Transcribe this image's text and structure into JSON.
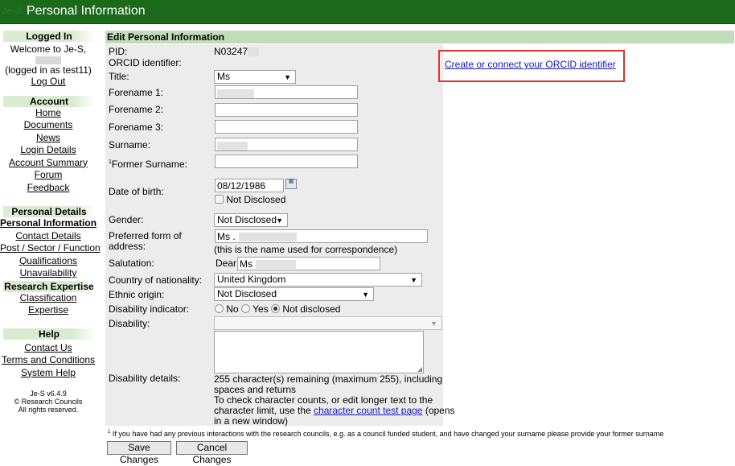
{
  "header": {
    "logo_text": "Je-S",
    "title": "Personal Information"
  },
  "sidebar": {
    "logged_in": {
      "heading": "Logged In",
      "welcome": "Welcome to Je-S,",
      "logged_as": "(logged in as test11)",
      "logout": "Log Out"
    },
    "account": {
      "heading": "Account",
      "items": [
        "Home",
        "Documents",
        "News",
        "Login Details",
        "Account Summary",
        "Forum",
        "Feedback"
      ]
    },
    "personal": {
      "heading": "Personal Details",
      "items": [
        "Personal Information",
        "Contact Details",
        "Post / Sector / Function",
        "Qualifications",
        "Unavailability"
      ]
    },
    "research": {
      "heading": "Research Expertise",
      "items": [
        "Classification",
        "Expertise"
      ]
    },
    "help": {
      "heading": "Help",
      "items": [
        "Contact Us",
        "Terms and Conditions",
        "System Help"
      ]
    },
    "footer": {
      "version": "Je-S v6.4.9",
      "copyright": "© Research Councils",
      "rights": "All rights reserved."
    }
  },
  "form": {
    "heading": "Edit Personal Information",
    "pid_label": "PID:",
    "pid_value": "N03247",
    "orcid_label": "ORCID identifier:",
    "orcid_link": "Create or connect your ORCID identifier",
    "title_label": "Title:",
    "title_value": "Ms",
    "forename1_label": "Forename 1:",
    "forename2_label": "Forename 2:",
    "forename3_label": "Forename 3:",
    "surname_label": "Surname:",
    "former_surname_label": "Former Surname:",
    "former_surname_sup": "1",
    "dob_label": "Date of birth:",
    "dob_value": "08/12/1986",
    "not_disclosed_label": "Not Disclosed",
    "gender_label": "Gender:",
    "gender_value": "Not Disclosed",
    "address_label_1": "Preferred form of",
    "address_label_2": "address:",
    "address_value": "Ms .",
    "address_note": "(this is the name used for correspondence)",
    "salutation_label": "Salutation:",
    "salutation_prefix": "Dear",
    "salutation_value": "Ms",
    "nationality_label": "Country of nationality:",
    "nationality_value": "United Kingdom",
    "ethnic_label": "Ethnic origin:",
    "ethnic_value": "Not Disclosed",
    "disability_ind_label": "Disability indicator:",
    "radio_no": "No",
    "radio_yes": "Yes",
    "radio_not_disclosed": "Not disclosed",
    "disability_label": "Disability:",
    "disability_value": "",
    "disability_details_label": "Disability details:",
    "chars_remaining_1": "255 character(s) remaining (maximum 255), including",
    "chars_remaining_2": "spaces and returns",
    "check_text_1": "To check character counts, or edit longer text to the",
    "check_text_2a": "character limit, use the",
    "check_link": "character count test page",
    "check_text_2b": "(opens",
    "check_text_3": "in a new window)",
    "footnote_sup": "1",
    "footnote": "If you have had any previous interactions with the research councils, e.g. as a council funded student, and have changed your surname please provide your former surname",
    "save_button": "Save Changes",
    "cancel_button": "Cancel Changes"
  },
  "colors": {
    "header_green": "#1a6a1a",
    "panel_green": "#bfddb8",
    "highlight_red": "#e2302b",
    "link_blue": "#1515c8"
  }
}
